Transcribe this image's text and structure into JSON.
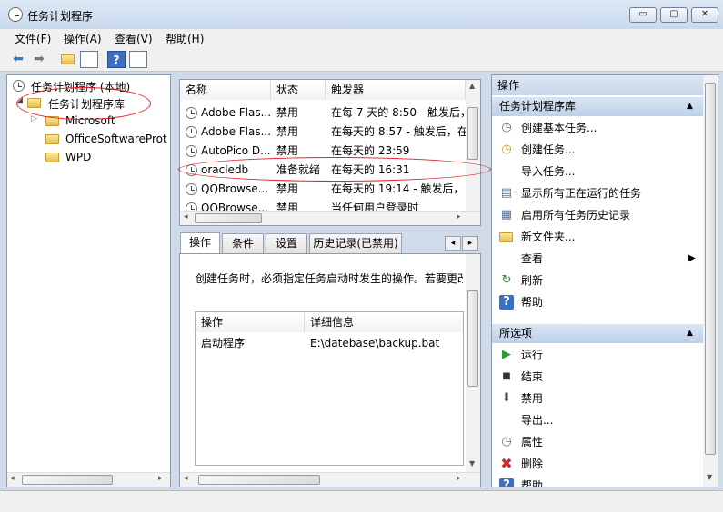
{
  "window": {
    "title": "任务计划程序",
    "minimize": "▭",
    "maximize": "▢",
    "close": "✕"
  },
  "menu": [
    "文件(F)",
    "操作(A)",
    "查看(V)",
    "帮助(H)"
  ],
  "tree": {
    "root": "任务计划程序 (本地)",
    "library": "任务计划程序库",
    "children": [
      "Microsoft",
      "OfficeSoftwareProte",
      "WPD"
    ]
  },
  "task_list": {
    "columns": [
      "名称",
      "状态",
      "触发器"
    ],
    "rows": [
      {
        "name": "Adobe Flas...",
        "status": "禁用",
        "trigger": "在每 7 天的 8:50 - 触发后，"
      },
      {
        "name": "Adobe Flas...",
        "status": "禁用",
        "trigger": "在每天的 8:57 - 触发后，在"
      },
      {
        "name": "AutoPico D...",
        "status": "禁用",
        "trigger": "在每天的 23:59"
      },
      {
        "name": "oracledb",
        "status": "准备就绪",
        "trigger": "在每天的 16:31"
      },
      {
        "name": "QQBrowse...",
        "status": "禁用",
        "trigger": "在每天的 19:14 - 触发后，"
      },
      {
        "name": "QQBrowse...",
        "status": "禁用",
        "trigger": "当任何用户登录时"
      }
    ]
  },
  "detail": {
    "tabs": [
      "操作",
      "条件",
      "设置",
      "历史记录(已禁用)"
    ],
    "description": "创建任务时，必须指定任务启动时发生的操作。若要更改",
    "columns": [
      "操作",
      "详细信息"
    ],
    "rows": [
      {
        "action": "启动程序",
        "details": "E:\\datebase\\backup.bat"
      }
    ]
  },
  "actions": {
    "header": "操作",
    "section1": "任务计划程序库",
    "items1": [
      "创建基本任务...",
      "创建任务...",
      "导入任务...",
      "显示所有正在运行的任务",
      "启用所有任务历史记录",
      "新文件夹...",
      "查看",
      "刷新",
      "帮助"
    ],
    "section2": "所选项",
    "items2": [
      "运行",
      "结束",
      "禁用",
      "导出...",
      "属性",
      "删除",
      "帮助"
    ]
  },
  "colors": {
    "accent": "#1f5fa8",
    "highlight_ellipse": "#e2242b"
  }
}
